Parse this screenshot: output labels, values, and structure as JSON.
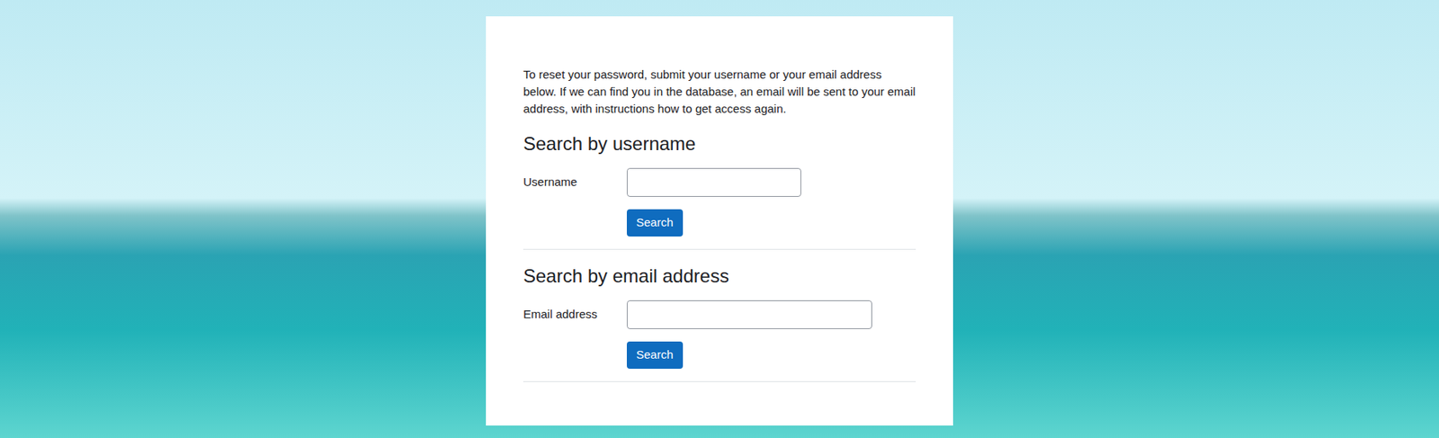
{
  "intro": "To reset your password, submit your username or your email address below. If we can find you in the database, an email will be sent to your email address, with instructions how to get access again.",
  "sections": [
    {
      "kind": "username",
      "heading": "Search by username",
      "label": "Username",
      "value": "",
      "button": "Search"
    },
    {
      "kind": "email",
      "heading": "Search by email address",
      "label": "Email address",
      "value": "",
      "button": "Search"
    }
  ]
}
